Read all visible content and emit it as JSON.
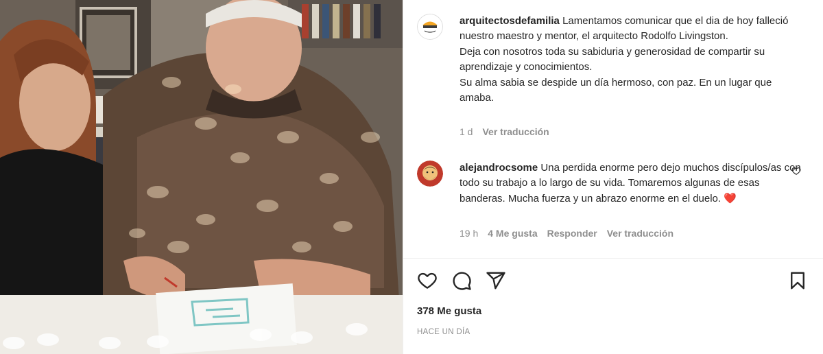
{
  "post": {
    "author": "arquitectosdefamilia",
    "caption": "Lamentamos comunicar que el dia de hoy falleció nuestro maestro y mentor, el arquitecto Rodolfo Livingston.",
    "caption_line2": "Deja con nosotros toda su sabiduria y generosidad de compartir su aprendizaje y conocimientos.",
    "caption_line3": "Su alma sabia se despide un día hermoso, con paz. En un lugar que amaba.",
    "time": "1 d",
    "translate": "Ver traducción",
    "avatar_icon": "arquitectos-de-familia-logo"
  },
  "comment": {
    "author": "alejandrocsome",
    "text": "Una perdida enorme pero dejo muchos discípulos/as con todo su trabajo a lo largo de su vida. Tomaremos algunas de esas banderas. Mucha fuerza y un abrazo enorme en el duelo.",
    "emoji": "❤️",
    "time": "19 h",
    "likes": "4 Me gusta",
    "reply": "Responder",
    "translate": "Ver traducción"
  },
  "actions": {
    "like_icon": "heart-icon",
    "comment_icon": "comment-icon",
    "share_icon": "share-icon",
    "save_icon": "bookmark-icon"
  },
  "footer": {
    "likes": "378 Me gusta",
    "date": "HACE UN DÍA"
  },
  "colors": {
    "text": "#262626",
    "secondary": "#8e8e8e",
    "heart_red": "#ed4956",
    "logo_orange": "#f5a623"
  }
}
